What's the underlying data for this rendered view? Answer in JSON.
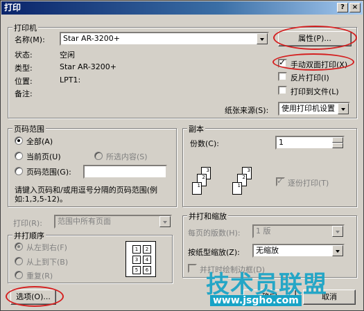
{
  "window": {
    "title": "打印",
    "close_label": "×",
    "help_label": "?"
  },
  "printer": {
    "group_label": "打印机",
    "name_label": "名称(M):",
    "name_value": "Star AR-3200+",
    "properties_label": "属性(P)...",
    "status_label": "状态:",
    "status_value": "空闲",
    "type_label": "类型:",
    "type_value": "Star AR-3200+",
    "where_label": "位置:",
    "where_value": "LPT1:",
    "comment_label": "备注:",
    "duplex_label": "手动双面打印(X)",
    "duplex_checked": true,
    "mirror_label": "反片打印(I)",
    "mirror_checked": false,
    "to_file_label": "打印到文件(L)",
    "to_file_checked": false,
    "source_label": "纸张来源(S):",
    "source_value": "使用打印机设置"
  },
  "page_range": {
    "group_label": "页码范围",
    "all_label": "全部(A)",
    "current_label": "当前页(U)",
    "selection_label": "所选内容(S)",
    "pages_label": "页码范围(G):",
    "pages_value": "",
    "selected": "all",
    "hint": "请键入页码和/或用逗号分隔的页码范围(例如:1,3,5-12)。"
  },
  "copies": {
    "group_label": "副本",
    "count_label": "份数(C):",
    "count_value": "1",
    "collate_label": "逐份打印(T)",
    "collate_checked": true
  },
  "print_what": {
    "label": "打印(R):",
    "value": "范围中所有页面"
  },
  "order": {
    "group_label": "并打顺序",
    "ltr_label": "从左到右(F)",
    "ttb_label": "从上到下(B)",
    "repeat_label": "重复(R)",
    "preview_pages": [
      "1",
      "2",
      "3",
      "4",
      "5",
      "6"
    ]
  },
  "zoom": {
    "group_label": "并打和缩放",
    "pps_label": "每页的版数(H):",
    "pps_value": "1 版",
    "scale_label": "按纸型缩放(Z):",
    "scale_value": "无缩放",
    "border_label": "并打时绘制边框(D)"
  },
  "footer": {
    "options_label": "选项(O)...",
    "ok_label": "确定",
    "cancel_label": "取消"
  },
  "watermark": {
    "text": "技术员联盟",
    "url": "www.jsgho.com"
  },
  "colors": {
    "highlight": "#d42020",
    "title_bar": "#0a246a",
    "face": "#d4d0c8"
  }
}
